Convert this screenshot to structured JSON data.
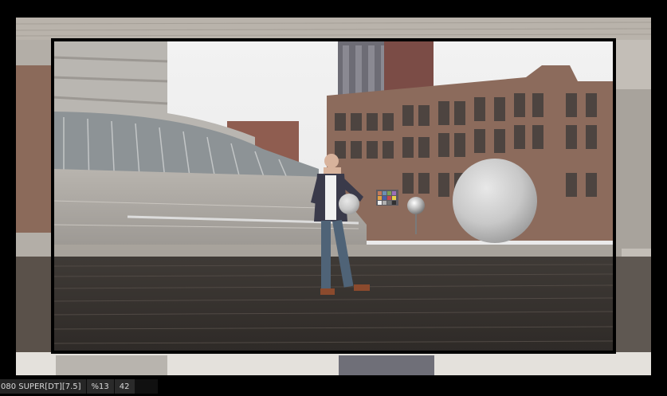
{
  "viewer": {
    "description_icon": "image-viewport"
  },
  "statusbar": {
    "format_label": "080 SUPER[DT][7.5]",
    "zoom_label": "%13",
    "frame_label": "42"
  },
  "colors": {
    "background": "#000000",
    "frame": "#2b2b2b",
    "statusbar_bg": "#2a2a2a",
    "statusbar_text": "#d8d8d8"
  }
}
